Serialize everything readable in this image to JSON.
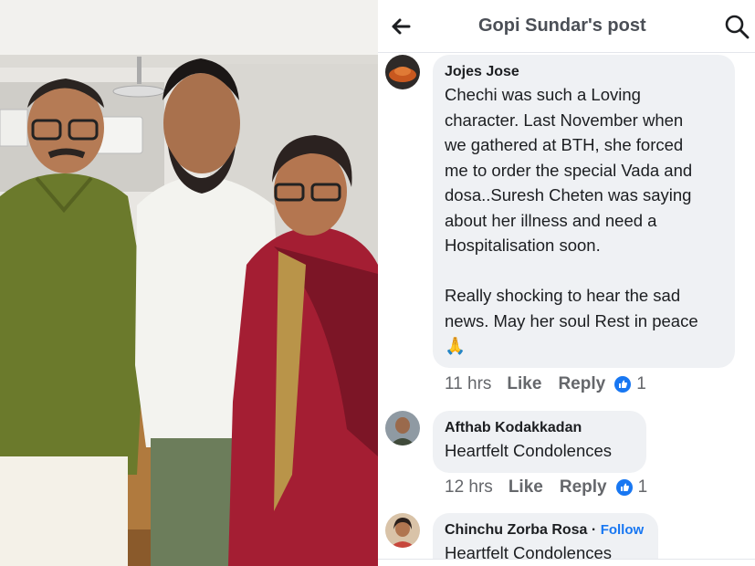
{
  "header": {
    "title": "Gopi Sundar's post",
    "back_icon": "arrow-left-icon",
    "search_icon": "search-icon"
  },
  "comments": [
    {
      "name": "Jojes Jose",
      "text": "Chechi was such a Loving\ncharacter. Last November when\nwe gathered at BTH, she forced\nme to order the special Vada and\ndosa..Suresh Cheten was saying\nabout her illness and need a\nHospitalisation soon.\n\nReally shocking to hear the sad\nnews. May her soul Rest in peace\n🙏",
      "time": "11 hrs",
      "like": "Like",
      "reply": "Reply",
      "reaction_count": "1"
    },
    {
      "name": "Afthab Kodakkadan",
      "text": "Heartfelt Condolences",
      "time": "12 hrs",
      "like": "Like",
      "reply": "Reply",
      "reaction_count": "1"
    },
    {
      "name": "Chinchu Zorba Rosa",
      "follow": "Follow",
      "text": "Heartfelt Condolences"
    }
  ],
  "colors": {
    "accent": "#1877f2",
    "bubble": "#eff1f4",
    "text": "#1c1e21",
    "meta": "#65676b"
  }
}
